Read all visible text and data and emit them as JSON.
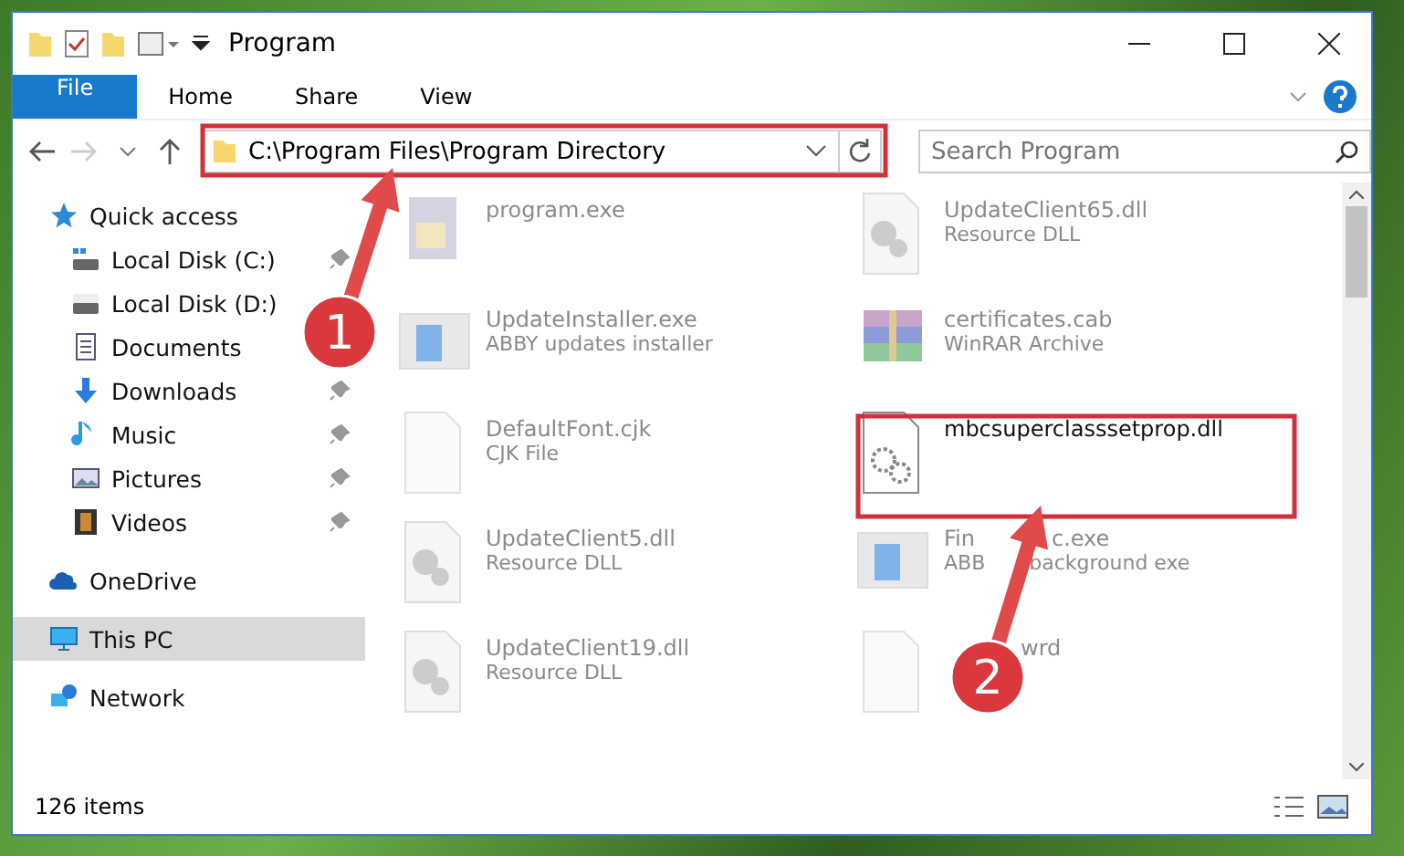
{
  "window": {
    "title": "Program"
  },
  "ribbon_tabs": [
    {
      "label": "File",
      "kind": "file"
    },
    {
      "label": "Home",
      "kind": "plain"
    },
    {
      "label": "Share",
      "kind": "plain"
    },
    {
      "label": "View",
      "kind": "plain"
    }
  ],
  "address_bar": {
    "path": "C:\\Program Files\\Program Directory"
  },
  "search": {
    "placeholder": "Search Program"
  },
  "sidebar": {
    "items": [
      {
        "label": "Quick access",
        "kind": "star",
        "selected": false,
        "children": [
          {
            "label": "Local Disk (C:)",
            "kind": "drive-c",
            "pinned": true
          },
          {
            "label": "Local Disk (D:)",
            "kind": "drive",
            "pinned": false
          },
          {
            "label": "Documents",
            "kind": "document",
            "pinned": false
          },
          {
            "label": "Downloads",
            "kind": "download",
            "pinned": true
          },
          {
            "label": "Music",
            "kind": "music",
            "pinned": true
          },
          {
            "label": "Pictures",
            "kind": "picture",
            "pinned": true
          },
          {
            "label": "Videos",
            "kind": "video",
            "pinned": true
          }
        ]
      },
      {
        "label": "OneDrive",
        "kind": "cloud",
        "selected": false
      },
      {
        "label": "This PC",
        "kind": "pc",
        "selected": true
      },
      {
        "label": "Network",
        "kind": "network",
        "selected": false
      }
    ]
  },
  "files": [
    {
      "name": "program.exe",
      "kind": "exe",
      "selected": false
    },
    {
      "name": "UpdateClient65.dll",
      "type": "Resource DLL",
      "kind": "dll",
      "selected": false
    },
    {
      "name": "UpdateInstaller.exe",
      "type": "ABBY updates installer",
      "kind": "app",
      "selected": false
    },
    {
      "name": "certificates.cab",
      "type": "WinRAR Archive",
      "kind": "archive",
      "selected": false
    },
    {
      "name": "DefaultFont.cjk",
      "type": "CJK File",
      "kind": "blank",
      "selected": false
    },
    {
      "name": "mbcsuperclasssetprop.dll",
      "kind": "gear",
      "selected": true
    },
    {
      "name": "UpdateClient5.dll",
      "type": "Resource DLL",
      "kind": "dll",
      "selected": false
    },
    {
      "name": "Fin",
      "name_tail": "c.exe",
      "type": "ABB",
      "type_tail": "background exe",
      "kind": "app",
      "selected": false
    },
    {
      "name": "UpdateClient19.dll",
      "type": "Resource DLL",
      "kind": "dll",
      "selected": false
    },
    {
      "name_tail": "wrd",
      "kind": "blank",
      "selected": false
    }
  ],
  "status_bar": {
    "count": "126 items"
  },
  "annotations": [
    {
      "label": "1"
    },
    {
      "label": "2"
    }
  ]
}
